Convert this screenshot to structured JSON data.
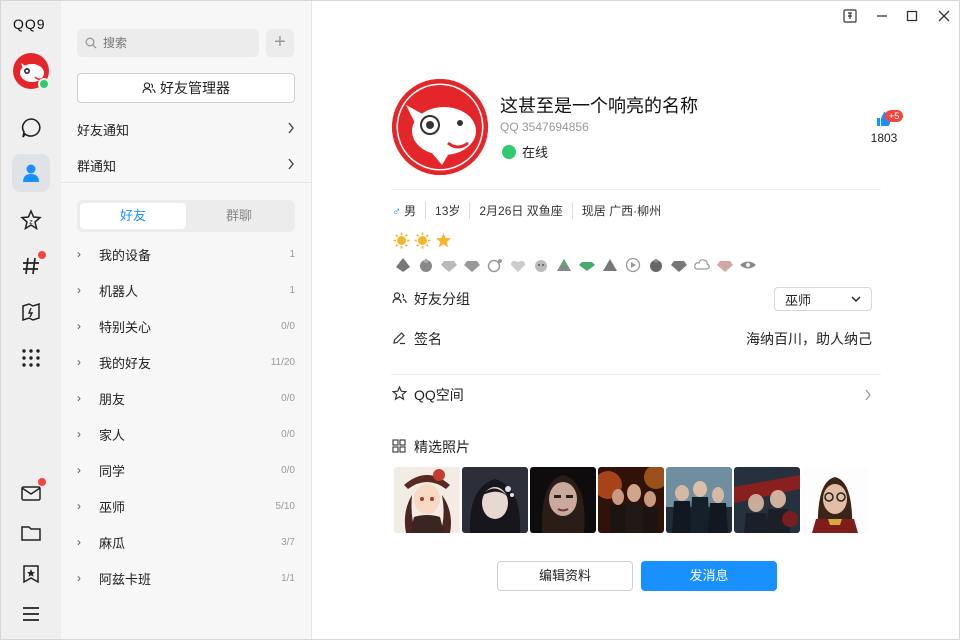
{
  "rail": {
    "logo": "QQ9",
    "items": [
      "message-icon",
      "contacts-icon",
      "star-icon",
      "hashtag-icon",
      "card-icon",
      "apps-grid-icon",
      "mail-icon",
      "folder-icon",
      "bookmark-icon",
      "menu-icon"
    ]
  },
  "list": {
    "search_placeholder": "搜索",
    "plus": "+",
    "manager_label": "好友管理器",
    "friend_notice": "好友通知",
    "group_notice": "群通知",
    "tab_friends": "好友",
    "tab_groups": "群聊",
    "groups": [
      {
        "name": "我的设备",
        "count": "1"
      },
      {
        "name": "机器人",
        "count": "1"
      },
      {
        "name": "特别关心",
        "count": "0/0"
      },
      {
        "name": "我的好友",
        "count": "11/20"
      },
      {
        "name": "朋友",
        "count": "0/0"
      },
      {
        "name": "家人",
        "count": "0/0"
      },
      {
        "name": "同学",
        "count": "0/0"
      },
      {
        "name": "巫师",
        "count": "5/10"
      },
      {
        "name": "麻瓜",
        "count": "3/7"
      },
      {
        "name": "阿兹卡班",
        "count": "1/1"
      }
    ]
  },
  "profile": {
    "nickname": "这甚至是一个响亮的名称",
    "qq_number": "QQ 3547694856",
    "status": "在线",
    "likes": "1803",
    "likes_plus": "+5",
    "gender": "男",
    "age": "13岁",
    "birthday": "2月26日 双鱼座",
    "location": "现居 广西·柳州",
    "friend_group_label": "好友分组",
    "friend_group_value": "巫师",
    "signature_label": "签名",
    "signature_value": "海纳百川，助人纳己",
    "qzone_label": "QQ空间",
    "photos_label": "精选照片",
    "edit_button": "编辑资料",
    "send_button": "发消息"
  },
  "colors": {
    "accent": "#1890ff",
    "online": "#2ecc71",
    "badge": "#f2463e",
    "avatar_red": "#e4262b"
  }
}
